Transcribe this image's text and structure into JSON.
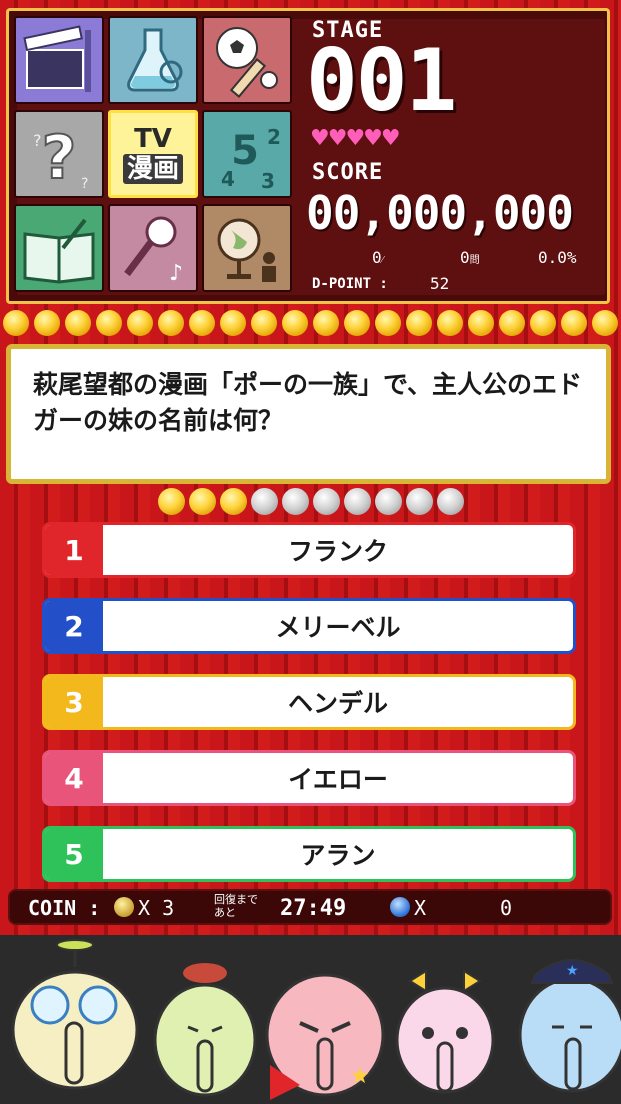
{
  "header": {
    "stage_label": "STAGE",
    "stage_number": "001",
    "hearts": "♥♥♥♥♥",
    "score_label": "SCORE",
    "score_value": "00,000,000",
    "correct_count": "0",
    "correct_unit": "⁄",
    "question_count": "0",
    "question_unit": "問",
    "accuracy": "0.0%",
    "dpoint_label": "D-POINT :",
    "dpoint_value": "52"
  },
  "genres": [
    {
      "name": "movie",
      "icon": "clapperboard-icon",
      "color": "#7b6ac7"
    },
    {
      "name": "science",
      "icon": "flask-icon",
      "color": "#5aa0b8"
    },
    {
      "name": "sports",
      "icon": "ball-bat-icon",
      "color": "#b8595c"
    },
    {
      "name": "random",
      "icon": "question-icon",
      "color": "#9a9a9a"
    },
    {
      "name": "tv-manga",
      "label_top": "TV",
      "label_bottom": "漫画",
      "selected": true
    },
    {
      "name": "math",
      "icon": "numbers-icon",
      "color": "#4e9e9e"
    },
    {
      "name": "literature",
      "icon": "book-icon",
      "color": "#3f9a68"
    },
    {
      "name": "music",
      "icon": "microphone-icon",
      "color": "#b87a94"
    },
    {
      "name": "society",
      "icon": "globe-icon",
      "color": "#a07a5a"
    }
  ],
  "question": {
    "text": "萩尾望都の漫画「ポーの一族」で、主人公のエドガーの妹の名前は何？",
    "progress_done": 3,
    "progress_total": 10
  },
  "answers": [
    {
      "num": "1",
      "text": "フランク",
      "color": "#e0262a"
    },
    {
      "num": "2",
      "text": "メリーベル",
      "color": "#2350c8"
    },
    {
      "num": "3",
      "text": "ヘンデル",
      "color": "#f2b81c"
    },
    {
      "num": "4",
      "text": "イエロー",
      "color": "#e8547a"
    },
    {
      "num": "5",
      "text": "アラン",
      "color": "#2fc25a"
    }
  ],
  "footer": {
    "coin_label": "COIN :",
    "coin_count": "X 3",
    "recover_label_1": "回復まで",
    "recover_label_2": "あと",
    "timer": "27:49",
    "gem_count": "X",
    "gem_value": "0"
  }
}
